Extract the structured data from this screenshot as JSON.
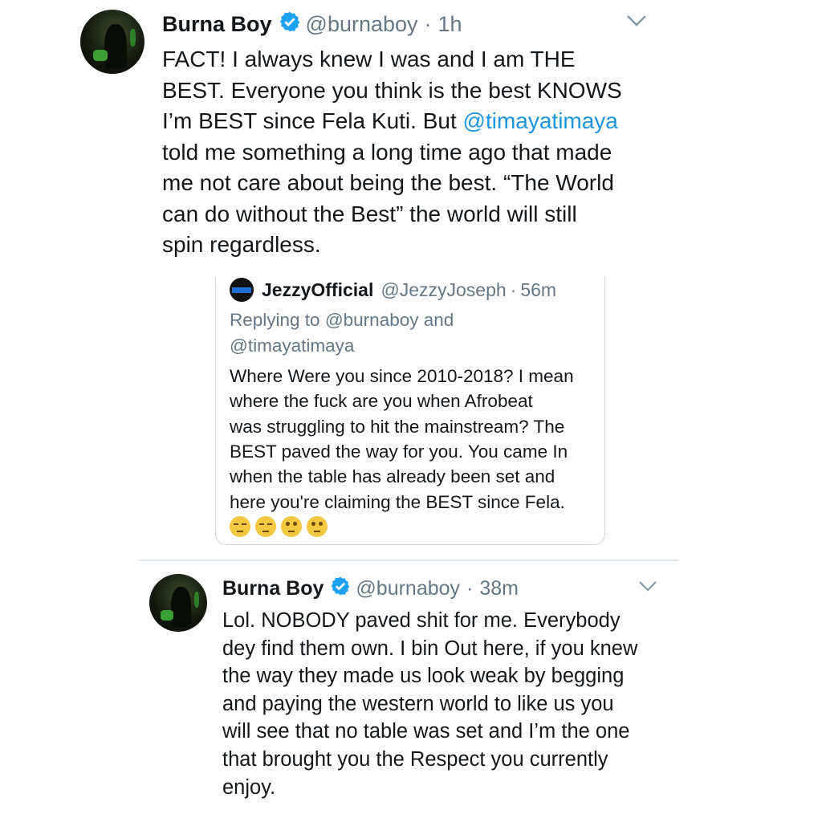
{
  "tweet1": {
    "display_name": "Burna Boy",
    "handle": "@burnaboy",
    "separator": "·",
    "time": "1h",
    "lines": [
      "FACT! I always knew I was and I am THE",
      "BEST. Everyone you think is the best KNOWS",
      "I’m BEST since Fela Kuti. But ",
      "told me something a long time ago that made",
      "me not care about being the best. “The World",
      "can do without the Best” the world will still",
      "spin regardless."
    ],
    "mention": "@timayatimaya"
  },
  "quote": {
    "display_name": "JezzyOfficial",
    "handle": "@JezzyJoseph",
    "separator": "·",
    "time": "56m",
    "replying_line1": "Replying to @burnaboy and",
    "replying_line2": "@timayatimaya",
    "lines": [
      "Where Were you since 2010-2018? I mean",
      "where the fuck are you when Afrobeat",
      "was struggling to hit the mainstream? The",
      "BEST paved the way for you. You came In",
      "when  the table has already been set and",
      "here you're claiming the  BEST since Fela."
    ],
    "emojis": [
      "unamused-face",
      "unamused-face",
      "face-with-rolling-eyes",
      "face-with-rolling-eyes"
    ]
  },
  "tweet2": {
    "display_name": "Burna Boy",
    "handle": "@burnaboy",
    "separator": "·",
    "time": "38m",
    "lines": [
      "Lol. NOBODY paved shit for me. Everybody",
      "dey find them own. I bin Out here, if you knew",
      "the way they made us look weak by begging",
      "and paying the western world to like us you",
      "will see that no table was set and I’m the one",
      "that brought you the Respect you currently",
      "enjoy."
    ]
  },
  "colors": {
    "text": "#14171a",
    "muted": "#657786",
    "mention": "#1b95e0",
    "verified": "#1da1f2",
    "border": "#ccd6dd"
  }
}
